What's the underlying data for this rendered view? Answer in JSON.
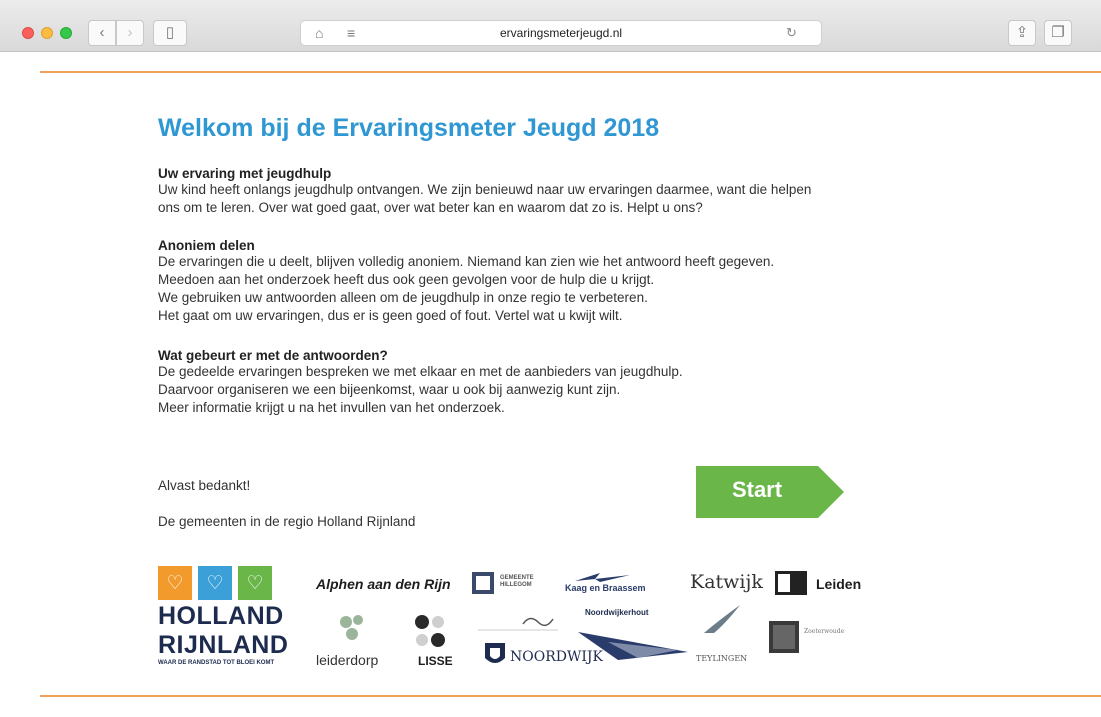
{
  "browser": {
    "url": "ervaringsmeterjeugd.nl"
  },
  "page": {
    "title": "Welkom bij de Ervaringsmeter Jeugd 2018",
    "sections": [
      {
        "heading": "Uw ervaring met jeugdhulp",
        "lines": [
          "Uw kind heeft onlangs jeugdhulp ontvangen. We zijn benieuwd naar uw ervaringen daarmee, want die helpen",
          "ons om te leren. Over wat goed gaat, over wat beter kan en waarom dat zo is. Helpt u ons?"
        ]
      },
      {
        "heading": "Anoniem delen",
        "lines": [
          "De ervaringen die u deelt, blijven volledig anoniem. Niemand kan zien wie het antwoord heeft gegeven.",
          "Meedoen aan het onderzoek heeft dus ook geen gevolgen voor de hulp die u krijgt.",
          "We gebruiken uw antwoorden alleen om de jeugdhulp in onze regio te verbeteren.",
          "Het gaat om uw ervaringen, dus er is geen goed of fout. Vertel wat u kwijt wilt."
        ]
      },
      {
        "heading": "Wat gebeurt er met de antwoorden?",
        "lines": [
          "De gedeelde ervaringen bespreken we met elkaar en met de aanbieders van jeugdhulp.",
          "Daarvoor organiseren we een bijeenkomst, waar u ook bij aanwezig kunt zijn.",
          "Meer informatie krijgt u na het invullen van het onderzoek."
        ]
      }
    ],
    "thanks": "Alvast bedankt!",
    "region": "De gemeenten in de regio Holland Rijnland",
    "start_label": "Start"
  },
  "logos": {
    "holland_rijnland_line1": "HOLLAND",
    "holland_rijnland_line2": "RIJNLAND",
    "holland_rijnland_tagline": "WAAR DE RANDSTAD TOT BLOEI KOMT",
    "alphen": "Alphen aan den Rijn",
    "hillegom": "GEMEENTE HILLEGOM",
    "kaag": "Kaag en Braassem",
    "katwijk": "Katwijk",
    "leiden": "Leiden",
    "leiderdorp": "leiderdorp",
    "lisse": "LISSE",
    "noordwijkerhout": "Noordwijkerhout",
    "noordwijk": "NOORDWIJK",
    "teylingen": "TEYLINGEN",
    "zoeterwoude": "Zoeterwoude"
  },
  "colors": {
    "title_blue": "#2f98d2",
    "accent_orange": "#f2a25b",
    "start_green": "#6ab648"
  }
}
